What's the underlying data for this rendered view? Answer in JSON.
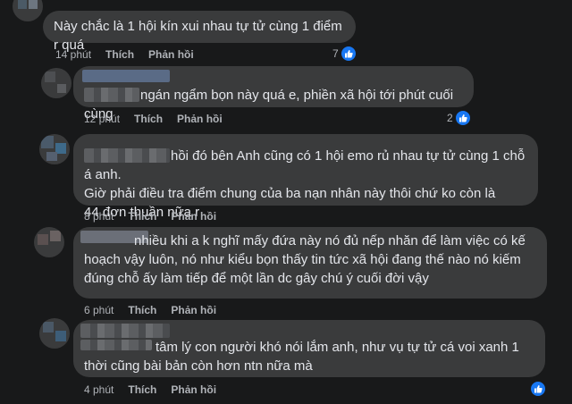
{
  "comments": [
    {
      "text": "Này chắc là 1 hội kín xui nhau tự tử cùng 1 điểm r quá",
      "time": "14 phút",
      "like_label": "Thích",
      "reply_label": "Phản hồi",
      "reaction_count": "7"
    },
    {
      "text": "ngán ngẩm bọn này quá e, phiền xã hội tới phút cuối cùng",
      "time": "12 phút",
      "like_label": "Thích",
      "reply_label": "Phản hồi",
      "reaction_count": "2"
    },
    {
      "text_line1": "hồi đó bên Anh cũng có 1 hội emo rủ nhau tự tử cùng 1 chỗ á anh.",
      "text_rest": "Giờ phải điều tra điểm chung của ba nạn nhân này thôi chứ ko còn là 44 đơn thuần nữa r",
      "time": "8 phút",
      "like_label": "Thích",
      "reply_label": "Phản hồi"
    },
    {
      "text_line1": "nhiều khi a k nghĩ mấy đứa này nó đủ nếp nhăn để làm việc có kế",
      "text_rest": "hoạch vậy luôn, nó như kiểu bọn thấy tin tức xã hội đang thế nào nó kiếm đúng chỗ ấy làm tiếp để một lần dc gây chú ý cuối đời vậy",
      "time": "6 phút",
      "like_label": "Thích",
      "reply_label": "Phản hồi"
    },
    {
      "text": "tâm lý con người khó nói lắm anh, như vụ tự tử cá voi xanh 1 thời cũng bài bản còn hơn ntn nữa mà",
      "time": "4 phút",
      "like_label": "Thích",
      "reply_label": "Phản hồi"
    }
  ],
  "colors": {
    "background": "#18191a",
    "bubble": "#3a3b3c",
    "text": "#e4e6eb",
    "meta": "#b0b3b8",
    "like_blue": "#1877f2"
  },
  "icons": [
    "like-icon"
  ]
}
